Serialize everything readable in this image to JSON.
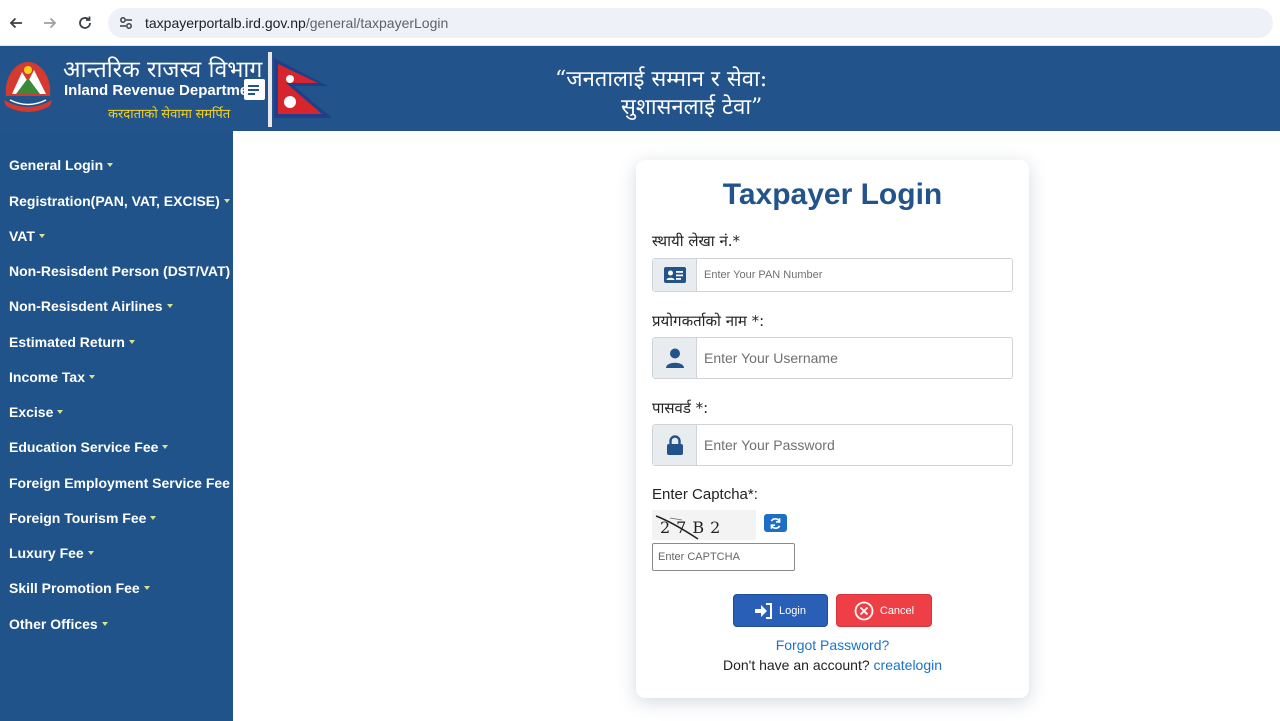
{
  "browser": {
    "url_host": "taxpayerportalb.ird.gov.np",
    "url_path": "/general/taxpayerLogin"
  },
  "header": {
    "org_name_np": "आन्तरिक राजस्व विभाग",
    "org_name_en": "Inland Revenue Department",
    "org_tagline": "करदाताको सेवामा समर्पित",
    "slogan_line1": "“जनतालाई सम्मान र सेवा:",
    "slogan_line2": "सुशासनलाई टेवा”"
  },
  "sidebar": {
    "items": [
      {
        "label": "General Login"
      },
      {
        "label": "Registration(PAN, VAT, EXCISE)"
      },
      {
        "label": "VAT"
      },
      {
        "label": "Non-Resisdent Person (DST/VAT)"
      },
      {
        "label": "Non-Resisdent Airlines"
      },
      {
        "label": "Estimated Return"
      },
      {
        "label": "Income Tax"
      },
      {
        "label": "Excise"
      },
      {
        "label": "Education Service Fee"
      },
      {
        "label": "Foreign Employment Service Fee"
      },
      {
        "label": "Foreign Tourism Fee"
      },
      {
        "label": "Luxury Fee"
      },
      {
        "label": "Skill Promotion Fee"
      },
      {
        "label": "Other Offices"
      }
    ]
  },
  "login": {
    "title": "Taxpayer Login",
    "pan_label": "स्थायी लेखा नं.*",
    "pan_placeholder": "Enter Your PAN Number",
    "username_label": "प्रयोगकर्ताको नाम *:",
    "username_placeholder": "Enter Your Username",
    "password_label": "पासवर्ड *:",
    "password_placeholder": "Enter Your Password",
    "captcha_label": "Enter Captcha*:",
    "captcha_text": "27B2",
    "captcha_placeholder": "Enter CAPTCHA",
    "login_button": "Login",
    "cancel_button": "Cancel",
    "forgot_password": "Forgot Password?",
    "no_account_text": "Don't have an account?",
    "create_login": "createlogin"
  },
  "colors": {
    "primary": "#22538a",
    "sidebar": "#1f5389",
    "login_button": "#2a5fb8",
    "cancel_button": "#ef3f46",
    "link": "#1a73c9"
  }
}
